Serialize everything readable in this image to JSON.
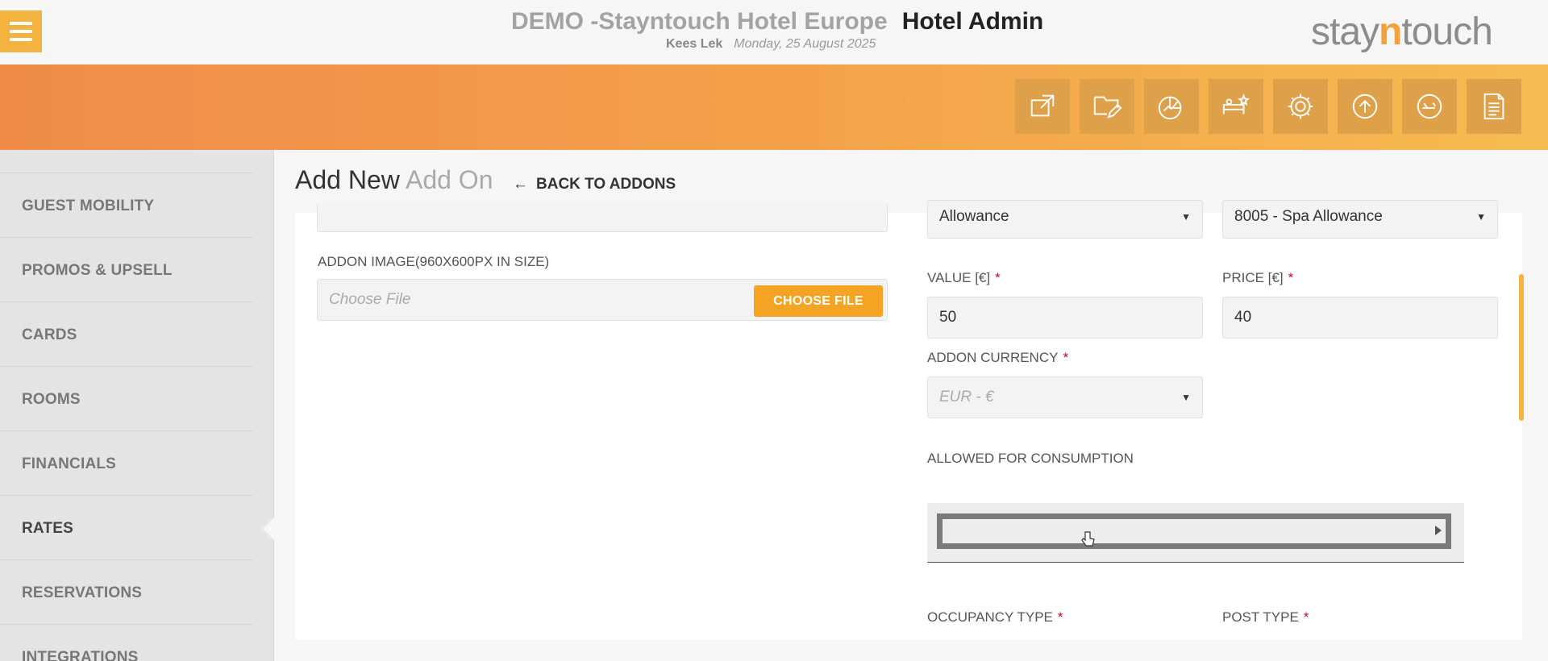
{
  "header": {
    "hotel_name": "DEMO -Stayntouch Hotel Europe",
    "app_title": "Hotel Admin",
    "user": "Kees Lek",
    "date": "Monday, 25 August 2025",
    "logo_left": "stay",
    "logo_mid": "n",
    "logo_right": "touch"
  },
  "toolbar": {
    "icons": [
      "external-link-icon",
      "folder-edit-icon",
      "analytics-icon",
      "bed-star-icon",
      "gear-icon",
      "upload-icon",
      "guest-icon",
      "document-icon"
    ]
  },
  "sidebar": {
    "items": [
      {
        "label": "GUEST MOBILITY"
      },
      {
        "label": "PROMOS & UPSELL"
      },
      {
        "label": "CARDS"
      },
      {
        "label": "ROOMS"
      },
      {
        "label": "FINANCIALS"
      },
      {
        "label": "RATES"
      },
      {
        "label": "RESERVATIONS"
      },
      {
        "label": "INTEGRATIONS"
      }
    ],
    "active_index": 5
  },
  "page": {
    "title_main": "Add New",
    "title_muted": "Add On",
    "back_label": "BACK TO ADDONS"
  },
  "form": {
    "allowance_value": "Allowance",
    "charge_code_value": "8005 - Spa Allowance",
    "image_label": "ADDON IMAGE(960X600PX IN SIZE)",
    "file_placeholder": "Choose File",
    "choose_file_label": "CHOOSE FILE",
    "value_label": "VALUE [€]",
    "value": "50",
    "price_label": "PRICE [€]",
    "price": "40",
    "currency_label": "ADDON CURRENCY",
    "currency_value": "EUR - €",
    "consumption_label": "ALLOWED FOR CONSUMPTION",
    "occupancy_label": "OCCUPANCY TYPE",
    "post_type_label": "POST TYPE",
    "required_mark": "*"
  },
  "colors": {
    "accent": "#f4a422",
    "band_start": "#f08b4a",
    "band_end": "#f6bb52",
    "required": "#d0021b"
  }
}
